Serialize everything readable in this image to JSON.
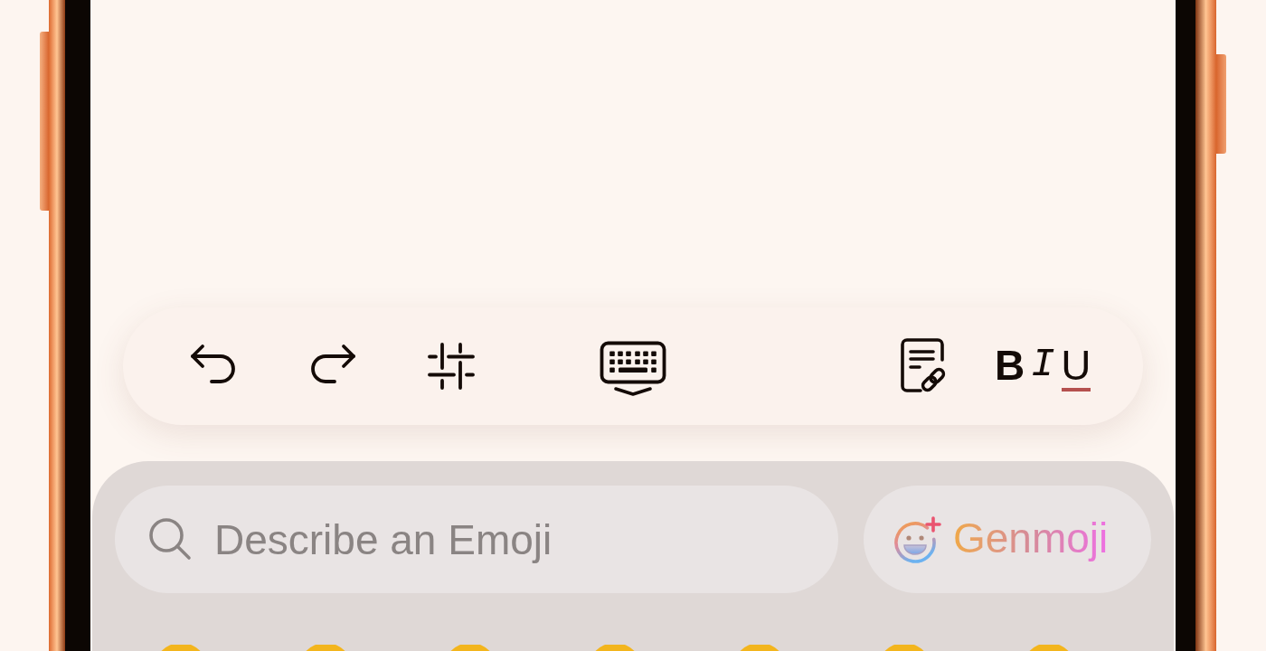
{
  "toolbar": {
    "text_styles": [
      {
        "kind": "bold",
        "label": "B"
      },
      {
        "kind": "italic",
        "label": "I"
      },
      {
        "kind": "underline",
        "label": "U"
      }
    ]
  },
  "emoji_keyboard": {
    "search": {
      "placeholder": "Describe an Emoji"
    },
    "genmoji_button": {
      "label": "Genmoji"
    }
  }
}
